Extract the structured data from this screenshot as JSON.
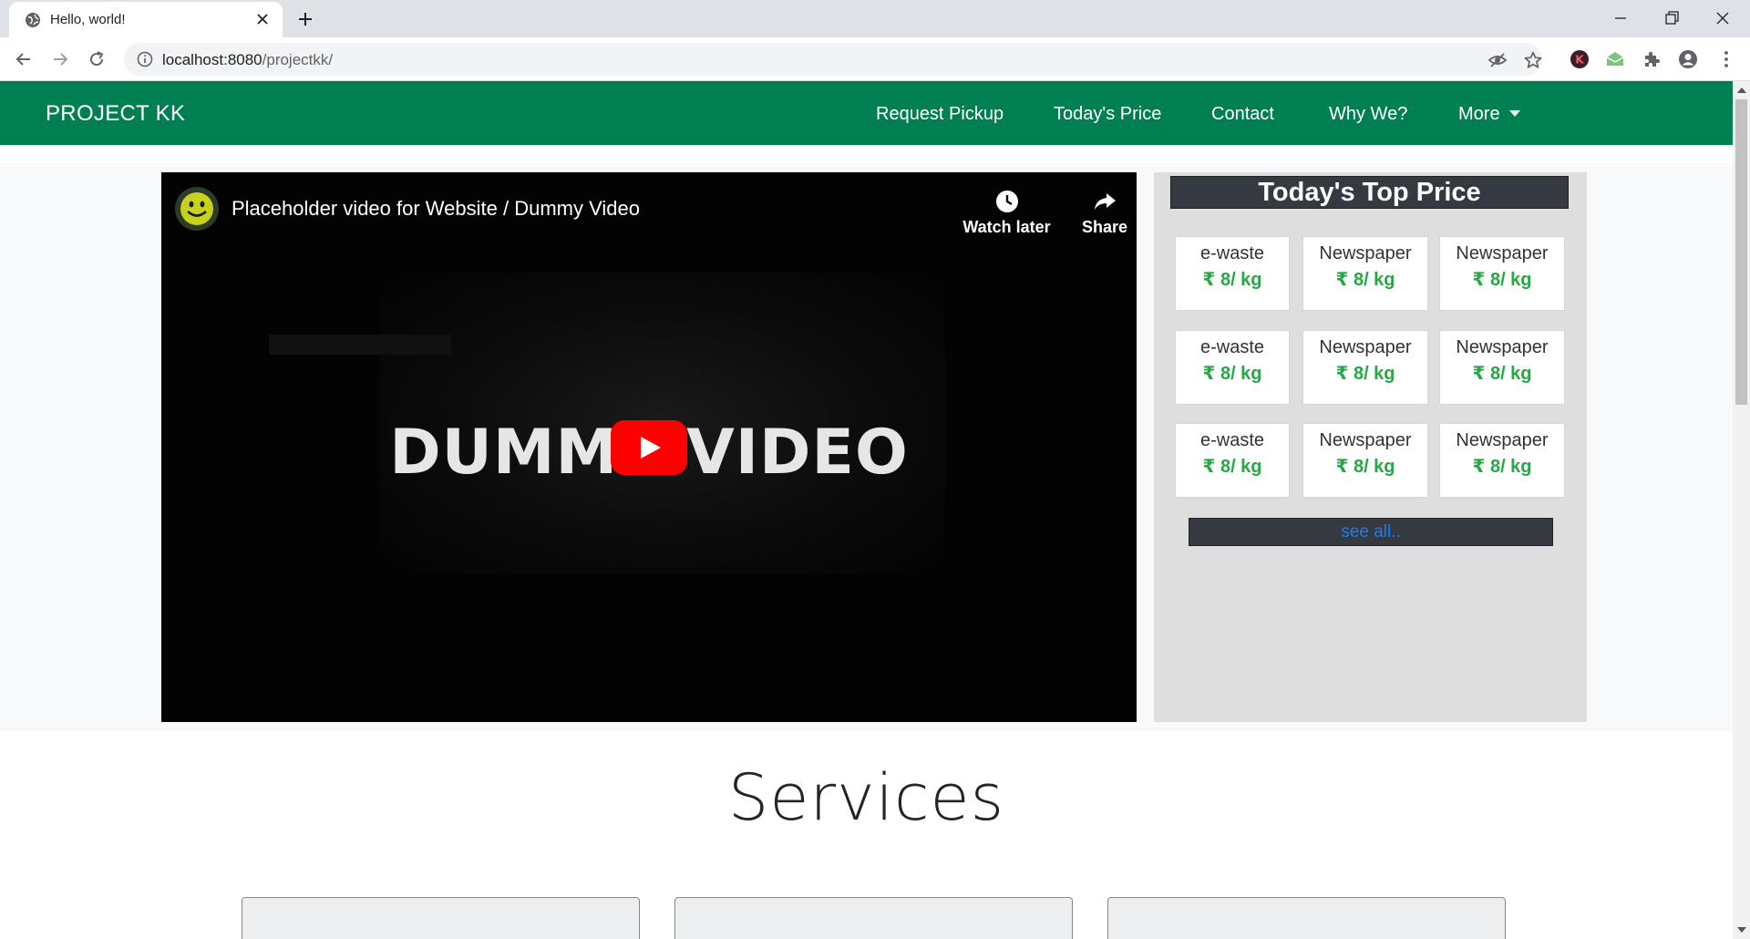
{
  "browser": {
    "tab_title": "Hello, world!",
    "url_host": "localhost:8080",
    "url_path": "/projectkk/",
    "ext_k_label": "K"
  },
  "site": {
    "brand": "PROJECT KK",
    "nav": [
      {
        "label": "Request Pickup"
      },
      {
        "label": "Today's Price"
      },
      {
        "label": "Contact"
      },
      {
        "label": "Why We?"
      },
      {
        "label": "More"
      }
    ],
    "accent_color": "#008052"
  },
  "video": {
    "title": "Placeholder video for Website / Dummy Video",
    "watch_later": "Watch later",
    "share": "Share",
    "thumbnail_text": "DUMMY VIDEO"
  },
  "price_panel": {
    "heading": "Today's Top Price",
    "items": [
      {
        "name": "e-waste",
        "price": "₹ 8/ kg"
      },
      {
        "name": "Newspaper",
        "price": "₹ 8/ kg"
      },
      {
        "name": "Newspaper",
        "price": "₹ 8/ kg"
      },
      {
        "name": "e-waste",
        "price": "₹ 8/ kg"
      },
      {
        "name": "Newspaper",
        "price": "₹ 8/ kg"
      },
      {
        "name": "Newspaper",
        "price": "₹ 8/ kg"
      },
      {
        "name": "e-waste",
        "price": "₹ 8/ kg"
      },
      {
        "name": "Newspaper",
        "price": "₹ 8/ kg"
      },
      {
        "name": "Newspaper",
        "price": "₹ 8/ kg"
      }
    ],
    "see_all": "see all.."
  },
  "services": {
    "title": "Services"
  }
}
